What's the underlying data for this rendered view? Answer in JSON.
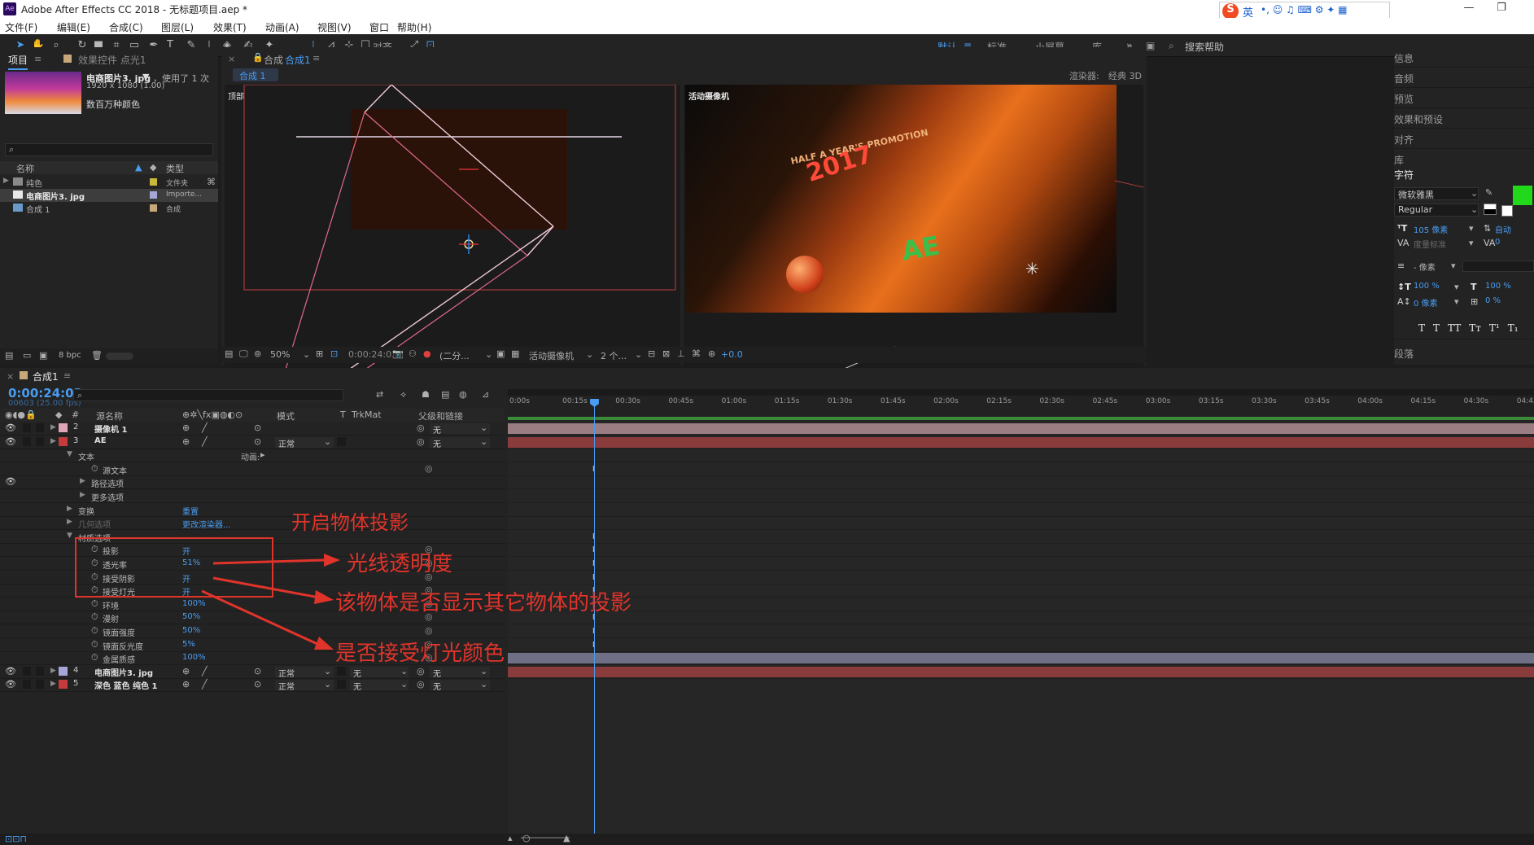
{
  "window": {
    "title": "Adobe After Effects CC 2018 - 无标题项目.aep *",
    "app_icon": "Ae"
  },
  "menu": [
    "文件(F)",
    "编辑(E)",
    "合成(C)",
    "图层(L)",
    "效果(T)",
    "动画(A)",
    "视图(V)",
    "窗口",
    "帮助(H)"
  ],
  "ime": {
    "label": "英",
    "brand": "S"
  },
  "toolbar": {
    "align_label": "对齐",
    "workspaces": [
      "默认",
      "标准",
      "小屏幕",
      "库"
    ],
    "search_placeholder": "搜索帮助"
  },
  "project_panel": {
    "tab_project": "项目",
    "tab_effects": "效果控件 点光1",
    "selected_item": {
      "name": "电商图片3. jpg",
      "usage": "，使用了 1 次",
      "dims": "1920 x 1080 (1.00)",
      "colors": "数百万种颜色"
    },
    "search_icon": "⌕",
    "col_name": "名称",
    "col_type": "类型",
    "items": [
      {
        "name": "纯色",
        "type": "文件夹",
        "color": "#c9b83a"
      },
      {
        "name": "电商图片3. jpg",
        "type": "Importe...",
        "color": "#a6a6d8"
      },
      {
        "name": "合成 1",
        "type": "合成",
        "color": "#c8a87a"
      }
    ],
    "bpc": "8 bpc"
  },
  "comp_panel": {
    "tab": "合成",
    "comp_name": "合成1",
    "subtab": "合成 1",
    "renderer_label": "渲染器:",
    "renderer_value": "经典 3D",
    "view_left_label": "顶部",
    "view_right_label": "活动摄像机",
    "zoom": "50%",
    "timecode": "0:00:24:03",
    "resolution": "(二分...",
    "camera": "活动摄像机",
    "views": "2 个...",
    "exposure": "+0.0",
    "scene_text": "HALF A YEAR'S PROMOTION",
    "scene_year": "2017",
    "scene_ae": "AE"
  },
  "right_panel": {
    "items": [
      "信息",
      "音频",
      "预览",
      "效果和预设",
      "对齐",
      "库"
    ],
    "character_title": "字符",
    "font": "微软雅黑",
    "style": "Regular",
    "font_size": "105 像素",
    "leading": "自动",
    "kerning": "度量标准",
    "tracking": "0",
    "stroke": "- 像素",
    "vscale": "100 %",
    "hscale": "100 %",
    "baseline": "0 像素",
    "tsume": "0 %",
    "fill_color": "#22d81b",
    "paragraph_title": "段落",
    "text_styles": [
      "T",
      "T",
      "TT",
      "Tт",
      "T¹",
      "T₁"
    ]
  },
  "timeline": {
    "tab": "合成1",
    "timecode": "0:00:24:03",
    "frames": "00603 (25.00 fps)",
    "col_source": "源名称",
    "col_mode": "模式",
    "col_t": "T",
    "col_trkmat": "TrkMat",
    "col_parent": "父级和链接",
    "ruler": [
      "0:00s",
      "00:15s",
      "00:30s",
      "00:45s",
      "01:00s",
      "01:15s",
      "01:30s",
      "01:45s",
      "02:00s",
      "02:15s",
      "02:30s",
      "02:45s",
      "03:00s",
      "03:15s",
      "03:30s",
      "03:45s",
      "04:00s",
      "04:15s",
      "04:30s",
      "04:45"
    ],
    "playhead_fraction": 0.084,
    "layers": [
      {
        "num": "2",
        "name": "摄像机 1",
        "color": "#e0a6b8",
        "mode": "",
        "trk": "",
        "parent": "无",
        "bar": "#9a7d83"
      },
      {
        "num": "3",
        "name": "AE",
        "color": "#c53a3a",
        "mode": "正常",
        "trk": "",
        "parent": "无",
        "bar": "#8a3b3b"
      }
    ],
    "text_group": {
      "label": "文本",
      "animate": "动画:"
    },
    "props_text": [
      "源文本",
      "路径选项",
      "更多选项"
    ],
    "transform": {
      "label": "变换",
      "value": "重置"
    },
    "geometry": {
      "label": "几何选项",
      "value": "更改渲染器..."
    },
    "material": {
      "label": "材质选项"
    },
    "material_props": [
      {
        "name": "投影",
        "value": "开"
      },
      {
        "name": "透光率",
        "value": "51%"
      },
      {
        "name": "接受阴影",
        "value": "开"
      },
      {
        "name": "接受灯光",
        "value": "开"
      },
      {
        "name": "环境",
        "value": "100%"
      },
      {
        "name": "漫射",
        "value": "50%"
      },
      {
        "name": "镜面强度",
        "value": "50%"
      },
      {
        "name": "镜面反光度",
        "value": "5%"
      },
      {
        "name": "金属质感",
        "value": "100%"
      }
    ],
    "bottom_layers": [
      {
        "num": "4",
        "name": "电商图片3. jpg",
        "color": "#a6a6d8",
        "mode": "正常",
        "trk": "无",
        "parent": "无",
        "bar": "#6f6f86"
      },
      {
        "num": "5",
        "name": "深色 蓝色 纯色 1",
        "color": "#c53a3a",
        "mode": "正常",
        "trk": "无",
        "parent": "无",
        "bar": "#8a3b3b"
      }
    ]
  },
  "annotations": {
    "a1": "开启物体投影",
    "a2": "光线透明度",
    "a3": "该物体是否显示其它物体的投影",
    "a4": "是否接受灯光颜色"
  }
}
